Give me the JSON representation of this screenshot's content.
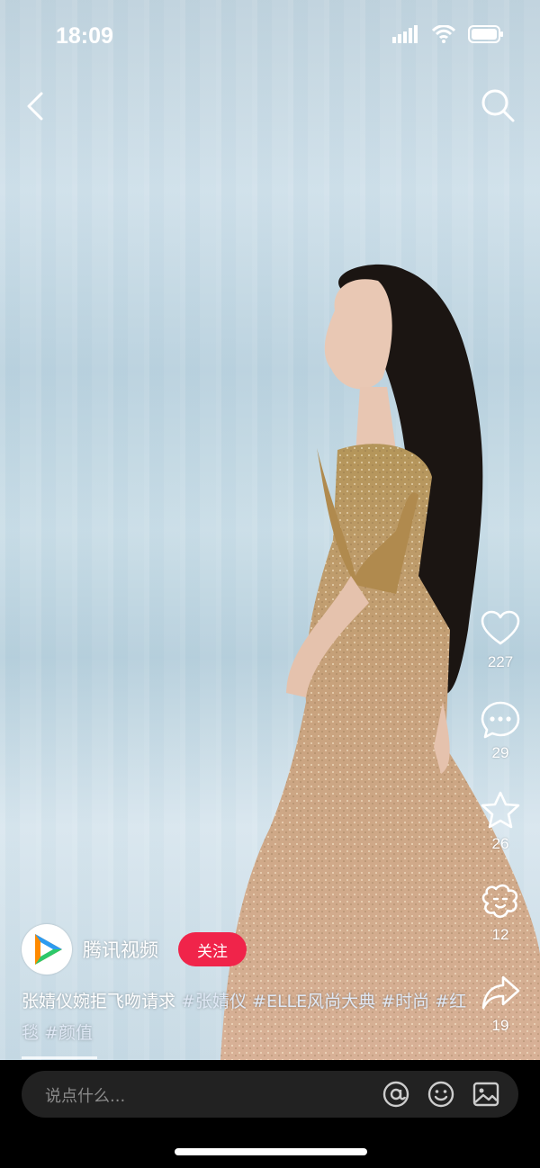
{
  "status": {
    "time": "18:09"
  },
  "nav": {
    "back_icon": "chevron-left-icon",
    "search_icon": "search-icon"
  },
  "actions": {
    "like": {
      "icon": "heart-icon",
      "count": "227"
    },
    "comment": {
      "icon": "comment-icon",
      "count": "29"
    },
    "favorite": {
      "icon": "star-icon",
      "count": "26"
    },
    "cheer": {
      "icon": "cheer-icon",
      "count": "12"
    },
    "share": {
      "icon": "share-icon",
      "count": "19"
    }
  },
  "author": {
    "name": "腾讯视频",
    "follow_label": "关注"
  },
  "caption": {
    "text": "张婧仪婉拒飞吻请求",
    "tags": [
      "#张婧仪",
      "#ELLE风尚大典",
      "#时尚",
      "#红毯",
      "#颜值"
    ]
  },
  "comment_bar": {
    "placeholder": "说点什么..."
  },
  "colors": {
    "follow": "#f0244a",
    "accent_tag": "#dfe8f5"
  },
  "progress": {
    "fraction": 0.14
  }
}
